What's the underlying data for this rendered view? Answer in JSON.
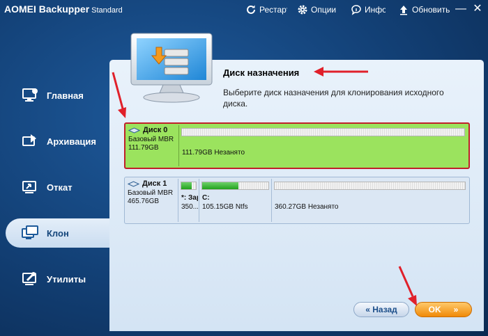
{
  "app": {
    "title": "AOMEI Backupper",
    "edition": "Standard"
  },
  "toolbar": {
    "restart_label": "Рестарт",
    "options_label": "Опции",
    "info_label": "Инфо",
    "update_label": "Обновить"
  },
  "sidebar": {
    "items": [
      {
        "label": "Главная",
        "icon": "home-monitor-icon"
      },
      {
        "label": "Архивация",
        "icon": "backup-icon"
      },
      {
        "label": "Откат",
        "icon": "restore-icon"
      },
      {
        "label": "Клон",
        "icon": "clone-icon",
        "active": true
      },
      {
        "label": "Утилиты",
        "icon": "tools-icon"
      }
    ]
  },
  "page": {
    "title": "Диск назначения",
    "description": "Выберите диск назначения для клонирования исходного диска."
  },
  "disks": [
    {
      "name": "Диск 0",
      "type": "Базовый MBR",
      "size": "111.79GB",
      "selected": true,
      "partitions": [
        {
          "label": "",
          "detail": "111.79GB Незанято",
          "used_fraction": 0
        }
      ]
    },
    {
      "name": "Диск 1",
      "type": "Базовый MBR",
      "size": "465.76GB",
      "selected": false,
      "partitions": [
        {
          "label": "*: Зарезервировано",
          "detail": "350...",
          "used_fraction": 0.7
        },
        {
          "label": "C:",
          "detail": "105.15GB Ntfs",
          "used_fraction": 0.55
        },
        {
          "label": "",
          "detail": "360.27GB Незанято",
          "used_fraction": 0
        }
      ]
    }
  ],
  "buttons": {
    "back_label": "Назад",
    "ok_label": "OK"
  },
  "colors": {
    "accent_orange": "#f08a08",
    "selected_disk": "#9be35e",
    "highlight_red": "#c0202a"
  }
}
